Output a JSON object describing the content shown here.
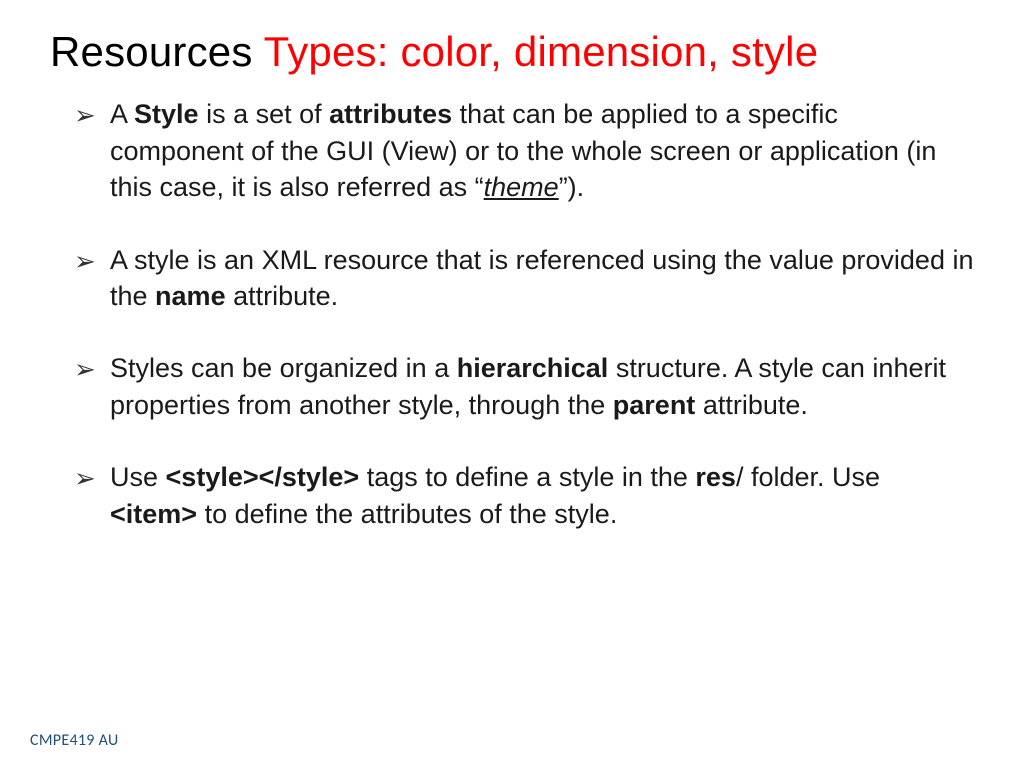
{
  "title": {
    "part_black": "Resources ",
    "part_red": "Types: color, dimension, style"
  },
  "bullets": {
    "b1": {
      "t1": "A ",
      "style_word": "Style",
      "t2": " is a set of ",
      "attributes_word": "attributes",
      "t3": " that can be applied to a specific component of the GUI (View) or to the whole screen or application (in this case, it is also referred as “",
      "theme_word": "theme",
      "t4": "”)."
    },
    "b2": {
      "t1": "A style is an XML resource that is referenced using the value provided in the ",
      "name_word": "name",
      "t2": " attribute."
    },
    "b3": {
      "t1": "Styles can be organized in a ",
      "hierarchical_word": "hierarchical",
      "t2": " structure. A style can inherit properties from another style, through the ",
      "parent_word": "parent",
      "t3": " attribute."
    },
    "b4": {
      "t1": "Use ",
      "style_tags": "<style></style>",
      "t2": " tags to define a style in the ",
      "res_word": "res",
      "t3": "/ folder. Use ",
      "item_tag": "<item>",
      "t4": " to define the attributes of the style."
    }
  },
  "footer": "CMPE419 AU"
}
